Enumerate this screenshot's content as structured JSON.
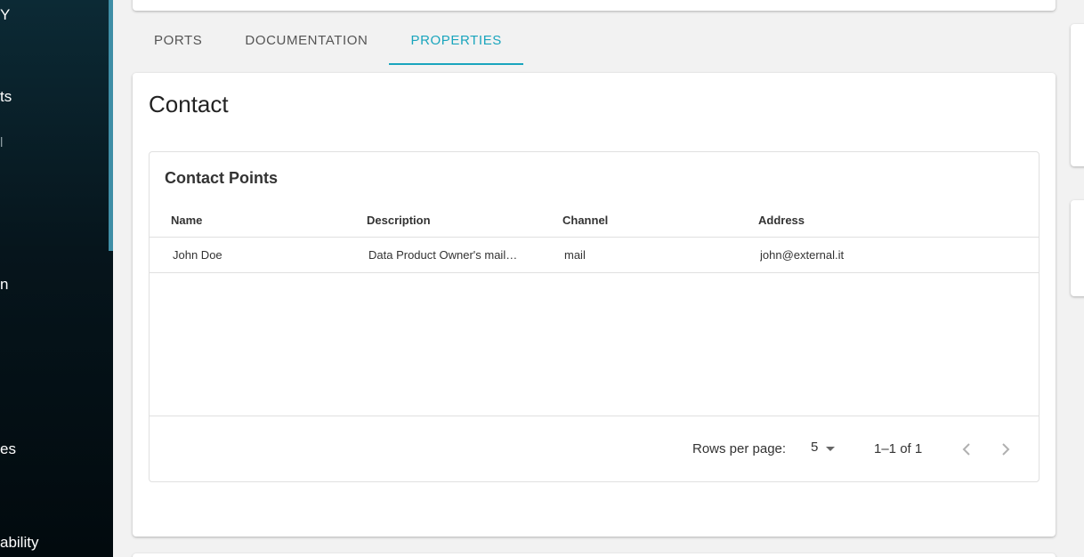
{
  "sidebar": {
    "items": [
      {
        "label": "Y"
      },
      {
        "label": "ts"
      },
      {
        "label": "l"
      },
      {
        "label": "n"
      },
      {
        "label": "es"
      },
      {
        "label": "ability"
      }
    ]
  },
  "tabs": [
    {
      "label": "PORTS",
      "active": false
    },
    {
      "label": "DOCUMENTATION",
      "active": false
    },
    {
      "label": "PROPERTIES",
      "active": true
    }
  ],
  "section": {
    "title": "Contact",
    "table": {
      "title": "Contact Points",
      "columns": [
        "Name",
        "Description",
        "Channel",
        "Address"
      ],
      "rows": [
        [
          "John Doe",
          "Data Product Owner's mail…",
          "mail",
          "john@external.it"
        ]
      ]
    },
    "pagination": {
      "rows_per_page_label": "Rows per page:",
      "rows_per_page_value": "5",
      "range": "1–1 of 1"
    }
  },
  "colors": {
    "accent": "#1aa5bd",
    "sidebar_bg": "#06151c"
  }
}
